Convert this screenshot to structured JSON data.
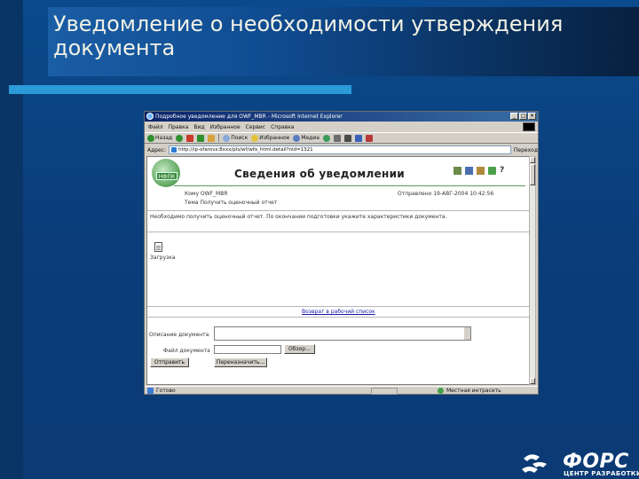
{
  "slide": {
    "title": "Уведомление о необходимости утверждения документа",
    "colors": {
      "background": "#0b3a74",
      "accent_bar": "#2a9bd8",
      "title_text": "#f1f1e6"
    }
  },
  "browser": {
    "window_title": "Подробное уведомление для OWF_MBR - Microsoft Internet Explorer",
    "window_buttons": [
      "_",
      "□",
      "✕"
    ],
    "menu": [
      "Файл",
      "Правка",
      "Вид",
      "Избранное",
      "Сервис",
      "Справка"
    ],
    "toolbar": {
      "back": "Назад",
      "search": "Поиск",
      "favorites": "Избранное",
      "media": "Медиа"
    },
    "address": {
      "label": "Адрес:",
      "url": "http://ip-ofarovs:8xxx/pls/wf/wfa_html.detail?nid=1321",
      "go": "Переход"
    },
    "page": {
      "logo_text": "НФПК",
      "heading": "Сведения об уведомлении",
      "help": "?",
      "to_label": "Кому OWF_MBR",
      "sent_label": "Отправлено  19-АВГ-2004 10:42:56",
      "subject_label": "Тема Получить оценочный отчет",
      "body_text": "Необходимо получить оценочный отчет. По окончании подготовки укажите характеристики документа.",
      "attachment_label": "Загрузка",
      "return_link": "Возврат в рабочий список",
      "description_label": "Описание документа",
      "file_label": "Файл документа",
      "browse_button": "Обзор...",
      "send_button": "Отправить",
      "redirect_button": "Переназначить..."
    },
    "status": {
      "left": "Готово",
      "zone": "Местная интрасеть"
    }
  },
  "branding": {
    "company": "ФОРС",
    "subtitle": "ЦЕНТР РАЗРАБОТКИ"
  }
}
